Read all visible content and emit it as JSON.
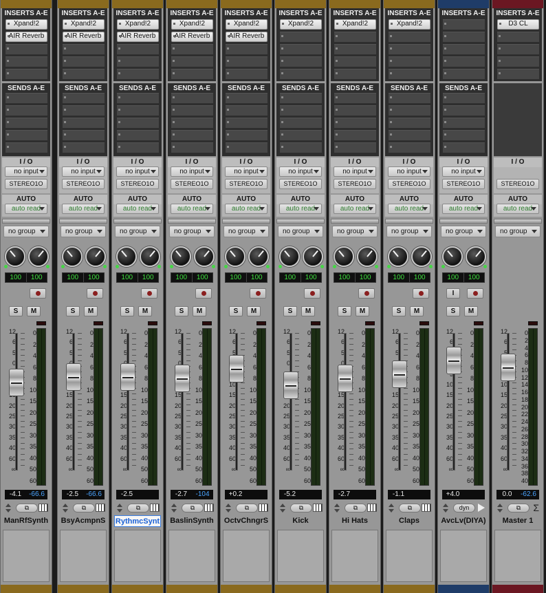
{
  "section_titles": {
    "inserts": "INSERTS A-E",
    "sends": "SENDS A-E",
    "io": "I / O",
    "auto": "AUTO"
  },
  "colors": {
    "strip_top_default": "#8a6a1e",
    "strip_top_avc": "#1f3c68",
    "strip_top_master": "#6b1722",
    "pan_text": "#3ee03e",
    "peak_text": "#4aa4ff",
    "auto_text": "#2e7d2e"
  },
  "fader_scale": [
    "12",
    "6",
    "5",
    "0",
    "5",
    "10",
    "15",
    "20",
    "25",
    "30",
    "35",
    "40",
    "60",
    "∞"
  ],
  "meter_scale": [
    "0",
    "2",
    "4",
    "6",
    "8",
    "10",
    "15",
    "20",
    "25",
    "30",
    "35",
    "40",
    "50",
    "60"
  ],
  "master_meter_scale": [
    "0",
    "2",
    "4",
    "6",
    "8",
    "10",
    "12",
    "14",
    "16",
    "18",
    "20",
    "22",
    "24",
    "26",
    "28",
    "30",
    "32",
    "34",
    "36",
    "38",
    "40"
  ],
  "strips": [
    {
      "name": "ManRfSynth",
      "inserts": [
        "Xpand!2",
        "AIR Reverb"
      ],
      "input": "no input",
      "output": "STEREO1O",
      "auto": "auto read",
      "group": "no group",
      "pan_l": "100",
      "pan_r": "100",
      "vol": "-4.1",
      "peak": "-66.6",
      "fader_level": 0.64,
      "selected": false,
      "kind": "normal"
    },
    {
      "name": "BsyAcmpnS",
      "inserts": [
        "Xpand!2",
        "AIR Reverb"
      ],
      "input": "no input",
      "output": "STEREO1O",
      "auto": "auto read",
      "group": "no group",
      "pan_l": "100",
      "pan_r": "100",
      "vol": "-2.5",
      "peak": "-66.6",
      "fader_level": 0.68,
      "selected": false,
      "kind": "normal"
    },
    {
      "name": "RythmcSynt",
      "inserts": [
        "Xpand!2",
        "AIR Reverb"
      ],
      "input": "no input",
      "output": "STEREO1O",
      "auto": "auto read",
      "group": "no group",
      "pan_l": "100",
      "pan_r": "100",
      "vol": "-2.5",
      "peak": "",
      "fader_level": 0.68,
      "selected": true,
      "kind": "normal"
    },
    {
      "name": "BaslinSynth",
      "inserts": [
        "Xpand!2",
        "AIR Reverb"
      ],
      "input": "no input",
      "output": "STEREO1O",
      "auto": "auto read",
      "group": "no group",
      "pan_l": "100",
      "pan_r": "100",
      "vol": "-2.7",
      "peak": "-104",
      "fader_level": 0.67,
      "selected": false,
      "kind": "normal"
    },
    {
      "name": "OctvChngrS",
      "inserts": [
        "Xpand!2",
        "AIR Reverb"
      ],
      "input": "no input",
      "output": "STEREO1O",
      "auto": "auto read",
      "group": "no group",
      "pan_l": "100",
      "pan_r": "100",
      "vol": "+0.2",
      "peak": "",
      "fader_level": 0.74,
      "selected": false,
      "kind": "normal"
    },
    {
      "name": "Kick",
      "inserts": [
        "Xpand!2"
      ],
      "input": "no input",
      "output": "STEREO1O",
      "auto": "auto read",
      "group": "no group",
      "pan_l": "100",
      "pan_r": "100",
      "vol": "-5.2",
      "peak": "",
      "fader_level": 0.62,
      "selected": false,
      "kind": "normal"
    },
    {
      "name": "Hi Hats",
      "inserts": [
        "Xpand!2"
      ],
      "input": "no input",
      "output": "STEREO1O",
      "auto": "auto read",
      "group": "no group",
      "pan_l": "100",
      "pan_r": "100",
      "vol": "-2.7",
      "peak": "",
      "fader_level": 0.67,
      "selected": false,
      "kind": "normal"
    },
    {
      "name": "Claps",
      "inserts": [
        "Xpand!2"
      ],
      "input": "no input",
      "output": "STEREO1O",
      "auto": "auto read",
      "group": "no group",
      "pan_l": "100",
      "pan_r": "100",
      "vol": "-1.1",
      "peak": "",
      "fader_level": 0.7,
      "selected": false,
      "kind": "normal"
    },
    {
      "name": "AvcLv(DIYA)",
      "inserts": [],
      "input": "no input",
      "output": "STEREO1O",
      "auto": "auto read",
      "group": "no group",
      "pan_l": "100",
      "pan_r": "100",
      "vol": "+4.0",
      "peak": "",
      "fader_level": 0.8,
      "selected": false,
      "kind": "avc",
      "input_btn": "I",
      "dyn_label": "dyn"
    },
    {
      "name": "Master 1",
      "inserts": [
        "D3 CL"
      ],
      "input": "",
      "output": "STEREO1O",
      "auto": "auto read",
      "group": "no group",
      "pan_l": "",
      "pan_r": "",
      "vol": "0.0",
      "peak": "-62.6",
      "fader_level": 0.75,
      "selected": false,
      "kind": "master",
      "sigma": "Σ"
    }
  ]
}
